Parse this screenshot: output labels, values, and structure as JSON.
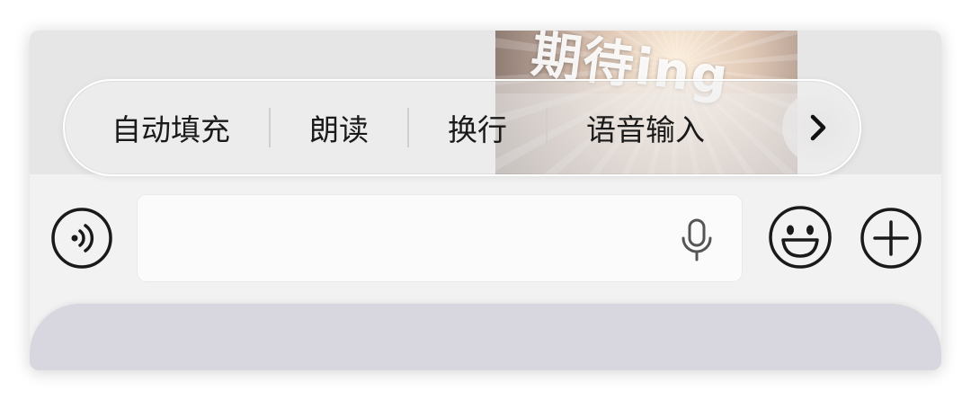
{
  "thumbnail": {
    "text": "期待ing"
  },
  "toolbar": {
    "items": [
      {
        "label": "自动填充"
      },
      {
        "label": "朗读"
      },
      {
        "label": "换行"
      },
      {
        "label": "语音输入"
      }
    ],
    "more_icon": "chevron-right-icon"
  },
  "input_bar": {
    "voice_toggle_icon": "voice-toggle-icon",
    "message_value": "",
    "mic_icon": "microphone-icon",
    "emoji_icon": "emoji-icon",
    "add_icon": "plus-icon"
  },
  "colors": {
    "keyboard_panel": "#d8d7df",
    "background": "#f2f2f2",
    "text": "#1a1a1a"
  }
}
